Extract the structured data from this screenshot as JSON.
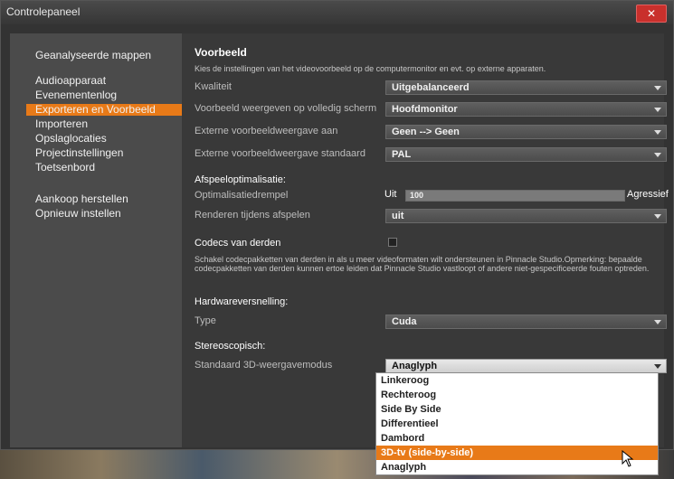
{
  "window": {
    "title": "Controlepaneel",
    "close_label": "✕"
  },
  "sidebar": {
    "items": [
      {
        "label": "Geanalyseerde mappen",
        "active": false
      },
      {
        "label": "Audioapparaat",
        "active": false
      },
      {
        "label": "Evenementenlog",
        "active": false
      },
      {
        "label": "Exporteren en Voorbeeld",
        "active": true
      },
      {
        "label": "Importeren",
        "active": false
      },
      {
        "label": "Opslaglocaties",
        "active": false
      },
      {
        "label": "Projectinstellingen",
        "active": false
      },
      {
        "label": "Toetsenbord",
        "active": false
      },
      {
        "label": "Aankoop herstellen",
        "active": false
      },
      {
        "label": "Opnieuw instellen",
        "active": false
      }
    ]
  },
  "main": {
    "section_title": "Voorbeeld",
    "section_desc": "Kies de instellingen van het videovoorbeeld op de computermonitor en evt. op externe apparaten.",
    "quality": {
      "label": "Kwaliteit",
      "value": "Uitgebalanceerd"
    },
    "fullscreen": {
      "label": "Voorbeeld weergeven op volledig scherm",
      "value": "Hoofdmonitor"
    },
    "external_on": {
      "label": "Externe voorbeeldweergave aan",
      "value": "Geen --> Geen"
    },
    "external_std": {
      "label": "Externe voorbeeldweergave standaard",
      "value": "PAL"
    },
    "playback_title": "Afspeeloptimalisatie:",
    "threshold": {
      "label": "Optimalisatiedrempel",
      "min_label": "Uit",
      "max_label": "Agressief",
      "value": "100",
      "fraction": 1.0
    },
    "render": {
      "label": "Renderen tijdens afspelen",
      "value": "uit"
    },
    "codecs_title": "Codecs van derden",
    "codecs_desc": "Schakel codecpakketten van derden in als u meer videoformaten wilt ondersteunen in Pinnacle Studio.Opmerking: bepaalde codecpakketten van derden kunnen ertoe leiden dat Pinnacle Studio vastloopt of andere niet-gespecificeerde fouten optreden.",
    "hw_title": "Hardwareversnelling:",
    "type": {
      "label": "Type",
      "value": "Cuda"
    },
    "stereo_title": "Stereoscopisch:",
    "stereo_mode": {
      "label": "Standaard 3D-weergavemodus",
      "value": "Anaglyph",
      "options": [
        "Linkeroog",
        "Rechteroog",
        "Side By Side",
        "Differentieel",
        "Dambord",
        "3D-tv (side-by-side)",
        "Anaglyph"
      ],
      "highlighted": "3D-tv (side-by-side)"
    }
  },
  "colors": {
    "accent": "#e87a18",
    "close": "#c9302c"
  }
}
